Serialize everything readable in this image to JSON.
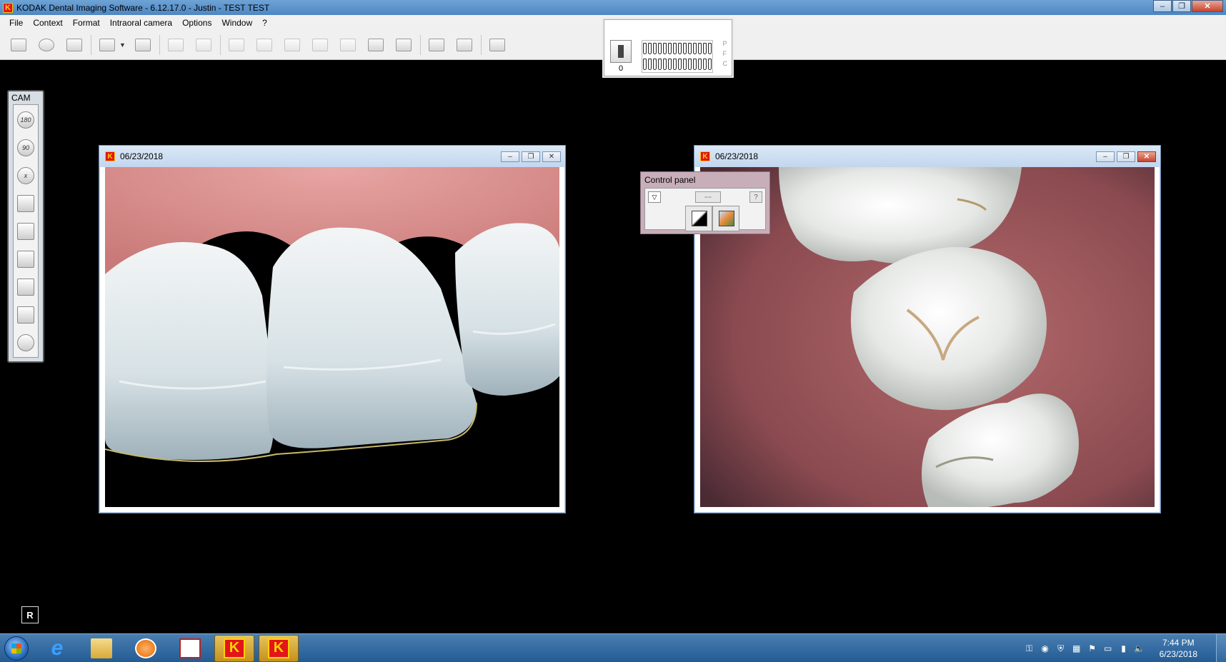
{
  "window": {
    "title": "KODAK Dental Imaging Software - 6.12.17.0 - Justin  - TEST TEST",
    "app_icon": "K",
    "min": "–",
    "max": "❐",
    "close": "✕"
  },
  "menu": {
    "file": "File",
    "context": "Context",
    "format": "Format",
    "intraoral": "Intraoral camera",
    "options": "Options",
    "window": "Window",
    "help": "?"
  },
  "odontogram": {
    "count": "0",
    "letters": [
      "P",
      "F",
      "C"
    ]
  },
  "cam_panel": {
    "title": "CAM",
    "tools": {
      "rotate180": "180",
      "rotate90": "90",
      "mirror": "x"
    }
  },
  "image_left": {
    "date": "06/23/2018"
  },
  "image_right": {
    "date": "06/23/2018"
  },
  "control_panel": {
    "title": "Control panel",
    "help": "?"
  },
  "r_box": "R",
  "taskbar": {
    "time": "7:44 PM",
    "date": "6/23/2018",
    "ie_glyph": "e",
    "kodak_glyph": "K"
  }
}
